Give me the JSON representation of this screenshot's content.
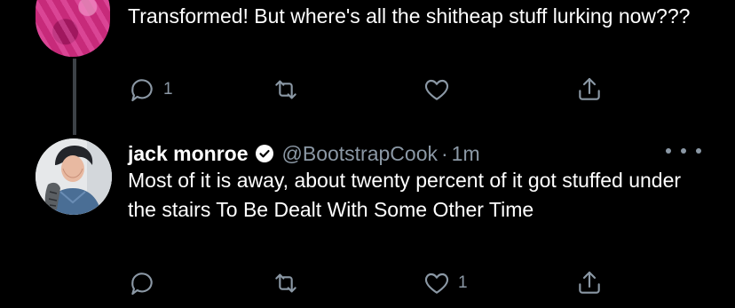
{
  "tweets": [
    {
      "text": "Transformed! But where's all the shitheap stuff lurking now???",
      "actions": {
        "reply_count": "1",
        "retweet_count": "",
        "like_count": "",
        "share_count": ""
      }
    },
    {
      "author_name": "jack monroe",
      "verified_icon": "verified-badge-icon",
      "handle": "@BootstrapCook",
      "separator": "·",
      "time": "1m",
      "text": "Most of it is away, about twenty percent of it got stuffed under the stairs To Be Dealt With Some Other Time",
      "actions": {
        "reply_count": "",
        "retweet_count": "",
        "like_count": "1",
        "share_count": ""
      }
    }
  ],
  "icons": {
    "reply": "reply-icon",
    "retweet": "retweet-icon",
    "like": "heart-icon",
    "share": "share-icon",
    "more": "more-dots-icon"
  },
  "colors": {
    "background": "#000000",
    "text": "#ffffff",
    "secondary": "#8b98a5",
    "thread_line": "#3d4247",
    "avatar_scribble": "#c72a7a"
  }
}
